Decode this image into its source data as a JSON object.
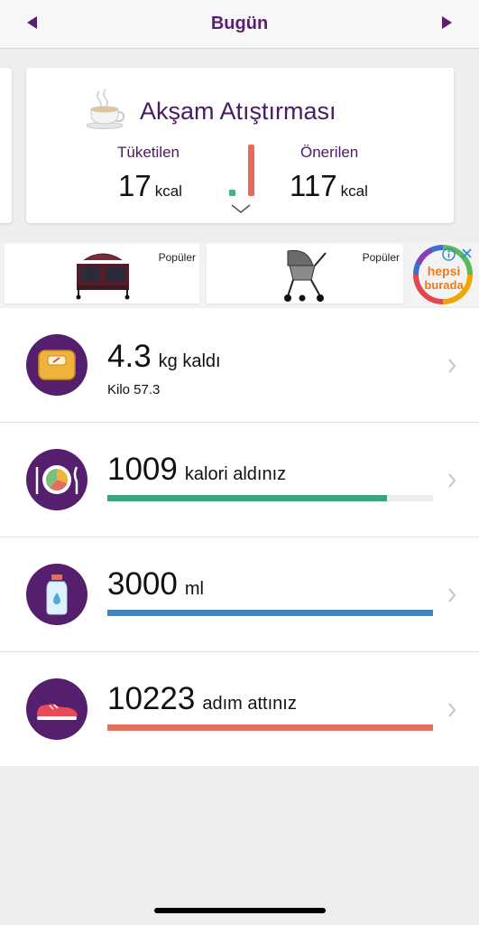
{
  "header": {
    "title": "Bugün",
    "prev_icon": "triangle-left-icon",
    "next_icon": "triangle-right-icon"
  },
  "meal": {
    "title": "Akşam Atıştırması",
    "icon": "tea-cup-icon",
    "consumed_label": "Tüketilen",
    "consumed_value": "17",
    "consumed_unit": "kcal",
    "recommended_label": "Önerilen",
    "recommended_value": "117",
    "recommended_unit": "kcal",
    "consumed_color": "#4caf82",
    "recommended_color": "#e56a5a"
  },
  "ads": {
    "items": [
      {
        "tag": "Popüler",
        "image": "baby-playpen-image"
      },
      {
        "tag": "Popüler",
        "image": "baby-stroller-image"
      }
    ],
    "brand_top": "hepsi",
    "brand_bottom": "burada"
  },
  "stats": {
    "weight": {
      "value": "4.3",
      "unit": "kg kaldı",
      "sub": "Kilo 57.3",
      "icon": "scale-icon"
    },
    "calories": {
      "value": "1009",
      "unit": "kalori aldınız",
      "progress": 0.86,
      "color": "#3aa57b",
      "icon": "plate-icon"
    },
    "water": {
      "value": "3000",
      "unit": "ml",
      "progress": 1.0,
      "color": "#3a86c8",
      "icon": "water-bottle-icon"
    },
    "steps": {
      "value": "10223",
      "unit": "adım attınız",
      "progress": 1.0,
      "color": "#e2705f",
      "icon": "sneaker-icon"
    }
  },
  "colors": {
    "accent": "#561f6e",
    "header_text": "#5a1f73"
  }
}
